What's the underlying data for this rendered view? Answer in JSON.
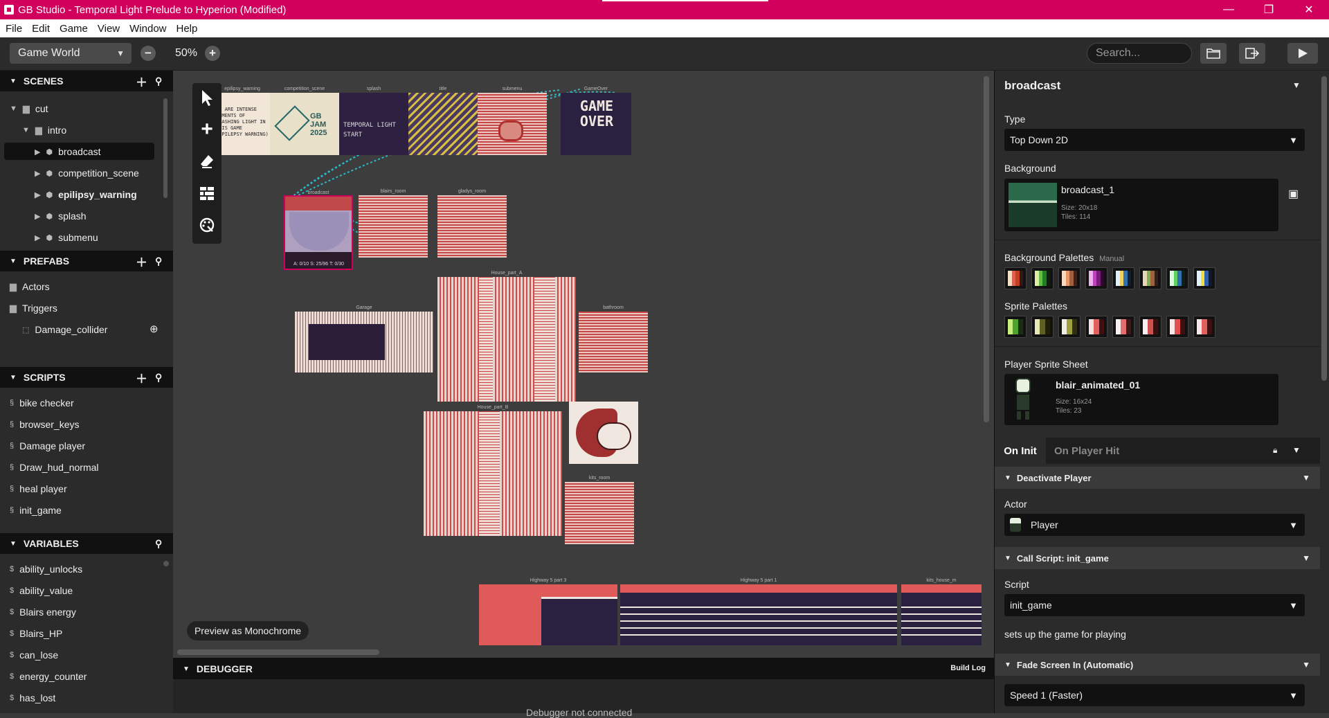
{
  "window": {
    "title": "GB Studio - Temporal Light Prelude to Hyperion (Modified)",
    "controls": {
      "minimize": "—",
      "maximize": "❐",
      "close": "✕"
    }
  },
  "menu": [
    "File",
    "Edit",
    "Game",
    "View",
    "Window",
    "Help"
  ],
  "toolbar": {
    "view_select": "Game World",
    "zoom_out": "−",
    "zoom_value": "50%",
    "zoom_in": "+",
    "search_placeholder": "Search...",
    "icons": [
      "folder-icon",
      "export-icon",
      "play-icon"
    ]
  },
  "sidebar": {
    "scenes": {
      "header": "SCENES",
      "items": [
        {
          "label": "cut",
          "type": "folder"
        },
        {
          "label": "intro",
          "type": "folder"
        },
        {
          "label": "broadcast",
          "type": "scene"
        },
        {
          "label": "competition_scene",
          "type": "scene"
        },
        {
          "label": "epilipsy_warning",
          "type": "scene"
        },
        {
          "label": "splash",
          "type": "scene"
        },
        {
          "label": "submenu",
          "type": "scene"
        }
      ]
    },
    "prefabs": {
      "header": "PREFABS",
      "items": [
        {
          "label": "Actors",
          "type": "folder"
        },
        {
          "label": "Triggers",
          "type": "folder"
        },
        {
          "label": "Damage_collider",
          "type": "prefab"
        }
      ]
    },
    "scripts": {
      "header": "SCRIPTS",
      "items": [
        "bike checker",
        "browser_keys",
        "Damage player",
        "Draw_hud_normal",
        "heal player",
        "init_game"
      ]
    },
    "variables": {
      "header": "VARIABLES",
      "items": [
        "ability_unlocks",
        "ability_value",
        "Blairs energy",
        "Blairs_HP",
        "can_lose",
        "energy_counter",
        "has_lost"
      ]
    }
  },
  "world": {
    "scenes": [
      {
        "label": "epilipsy_warning",
        "text": "WE ARE INTENSE MOMENTS OF FLASHING LIGHT IN THIS GAME (EPILEPSY WARNING)"
      },
      {
        "label": "competition_scene",
        "text": "GB JAM 2025"
      },
      {
        "label": "splash",
        "text": "TEMPORAL LIGHT START"
      },
      {
        "label": "title",
        "text": ""
      },
      {
        "label": "submenu",
        "text": ""
      },
      {
        "label": "GameOver",
        "text": "GAME OVER"
      },
      {
        "label": "broadcast",
        "text": ""
      },
      {
        "label": "blairs_room",
        "text": ""
      },
      {
        "label": "gladys_room",
        "text": ""
      },
      {
        "label": "House_part_A",
        "text": ""
      },
      {
        "label": "Garage",
        "text": ""
      },
      {
        "label": "bathroom",
        "text": ""
      },
      {
        "label": "House_part_B",
        "text": ""
      },
      {
        "label": "kits_room",
        "text": ""
      },
      {
        "label": "Highway 5 part 3",
        "text": ""
      },
      {
        "label": "Highway 5 part 1",
        "text": ""
      },
      {
        "label": "kits_house_m",
        "text": ""
      }
    ],
    "broadcast_stats": "A: 0/10   S: 25/96   T: 0/30",
    "preview_button": "Preview as Monochrome"
  },
  "debugger": {
    "header": "DEBUGGER",
    "build_log": "Build Log",
    "message": "Debugger not connected"
  },
  "panel": {
    "title": "broadcast",
    "type_label": "Type",
    "type_value": "Top Down 2D",
    "background_label": "Background",
    "background": {
      "name": "broadcast_1",
      "size": "Size:  20x18",
      "tiles": "Tiles:  114"
    },
    "bg_palettes_label": "Background Palettes",
    "bg_palettes_mode": "Manual",
    "bg_palettes": [
      [
        "#f2e0c8",
        "#e06050",
        "#c04020",
        "#301818"
      ],
      [
        "#d8f0a0",
        "#60c040",
        "#208020",
        "#102010"
      ],
      [
        "#f8d8c0",
        "#e89868",
        "#a06040",
        "#402018"
      ],
      [
        "#f0b0f0",
        "#c040c0",
        "#801880",
        "#300830"
      ],
      [
        "#e0f0f8",
        "#f0d060",
        "#3070b0",
        "#102030"
      ],
      [
        "#e8d8b8",
        "#80b050",
        "#a06040",
        "#302018"
      ],
      [
        "#e0f8e0",
        "#60d060",
        "#3070b0",
        "#102018"
      ],
      [
        "#e0f0f8",
        "#f0e040",
        "#3060b0",
        "#101830"
      ]
    ],
    "sprite_palettes_label": "Sprite Palettes",
    "sprite_palettes": [
      [
        "#c8f080",
        "#50a030",
        "#183010"
      ],
      [
        "#e8e8b8",
        "#606020",
        "#202008"
      ],
      [
        "#f0f0e0",
        "#a0a040",
        "#303010"
      ],
      [
        "#f8e0e0",
        "#e06060",
        "#401010"
      ],
      [
        "#f8f0f0",
        "#e07070",
        "#401818"
      ],
      [
        "#f8f0f0",
        "#d05050",
        "#381010"
      ],
      [
        "#f8e8e8",
        "#e05050",
        "#401010"
      ],
      [
        "#f8e8e8",
        "#e06060",
        "#401010"
      ]
    ],
    "player_sprite_label": "Player Sprite Sheet",
    "player_sprite": {
      "name": "blair_animated_01",
      "size": "Size:  16x24",
      "tiles": "Tiles:  23"
    },
    "event_tabs": [
      "On Init",
      "On Player Hit"
    ],
    "events": [
      {
        "title": "Deactivate Player",
        "field_label": "Actor",
        "field_value": "Player"
      },
      {
        "title": "Call Script: init_game",
        "field_label": "Script",
        "field_value": "init_game",
        "note": "sets up the game for playing"
      },
      {
        "title": "Fade Screen In (Automatic)",
        "field_value": "Speed 1 (Faster)"
      }
    ],
    "accent": "#d1005c"
  }
}
